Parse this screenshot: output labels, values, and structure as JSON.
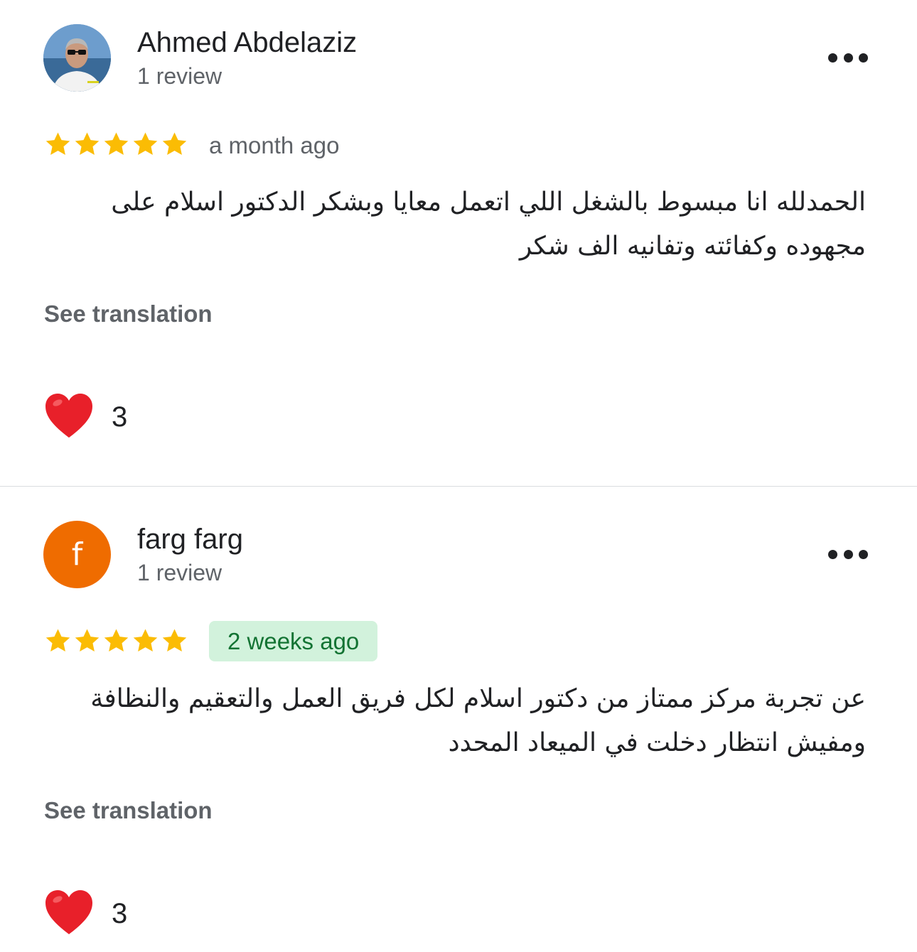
{
  "reviews": [
    {
      "author": "Ahmed Abdelaziz",
      "review_count": "1 review",
      "avatar": "photo",
      "rating": 5,
      "time": "a month ago",
      "time_highlighted": false,
      "text": "الحمدلله انا مبسوط بالشغل اللي اتعمل معايا وبشكر الدكتور اسلام على مجهوده وكفائته وتفانيه الف شكر",
      "see_translation": "See translation",
      "likes": "3",
      "more_icon": "more-horiz-icon"
    },
    {
      "author": "farg farg",
      "review_count": "1 review",
      "avatar_letter": "f",
      "avatar_color": "#ef6c00",
      "rating": 5,
      "time": "2 weeks ago",
      "time_highlighted": true,
      "text": "عن تجربة مركز ممتاز من دكتور اسلام لكل فريق العمل والتعقيم والنظافة ومفيش انتظار دخلت في الميعاد المحدد",
      "see_translation": "See translation",
      "likes": "3",
      "more_icon": "more-horiz-icon"
    }
  ],
  "colors": {
    "star": "#fbbc04",
    "heart": "#e8202a",
    "badge_bg": "#d2f2dc",
    "badge_text": "#137333"
  }
}
